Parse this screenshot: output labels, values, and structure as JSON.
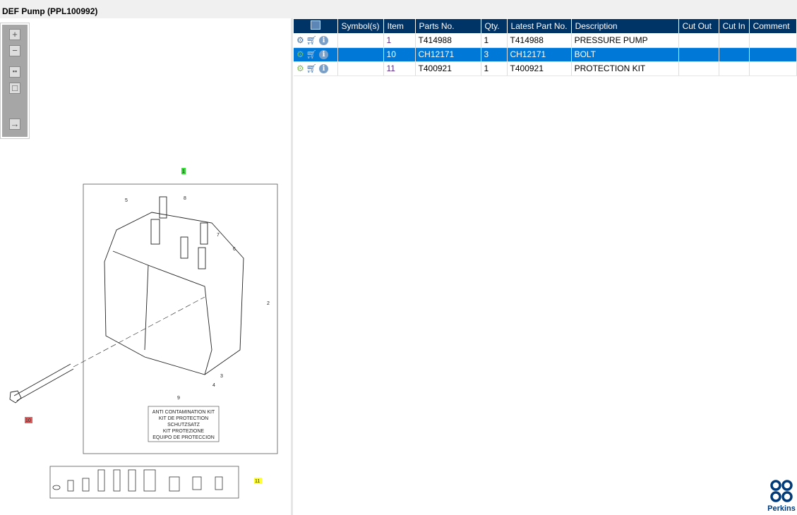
{
  "title": "DEF Pump (PPL100992)",
  "toolbar": {
    "icons": [
      "zoom-in-icon",
      "zoom-out-icon",
      "fit-all-icon",
      "fit-window-icon",
      "export-icon"
    ]
  },
  "table": {
    "columns": [
      "",
      "Symbol(s)",
      "Item",
      "Parts No.",
      "Qty.",
      "Latest Part No.",
      "Description",
      "Cut Out",
      "Cut In",
      "Comment"
    ],
    "rows": [
      {
        "symbols": "",
        "item": "1",
        "part": "T414988",
        "qty": "1",
        "latest": "T414988",
        "desc": "PRESSURE PUMP",
        "cut_out": "",
        "cut_in": "",
        "comment": ""
      },
      {
        "symbols": "",
        "item": "10",
        "part": "CH12171",
        "qty": "3",
        "latest": "CH12171",
        "desc": "BOLT",
        "cut_out": "",
        "cut_in": "",
        "comment": ""
      },
      {
        "symbols": "",
        "item": "11",
        "part": "T400921",
        "qty": "1",
        "latest": "T400921",
        "desc": "PROTECTION KIT",
        "cut_out": "",
        "cut_in": "",
        "comment": ""
      }
    ],
    "selected_row": 1
  },
  "diagram": {
    "callouts": [
      "1",
      "2",
      "3",
      "4",
      "5",
      "6",
      "7",
      "8",
      "9",
      "10",
      "11"
    ],
    "kit_label": [
      "ANTI CONTAMINATION KIT",
      "KIT DE PROTECTION",
      "SCHUTZSATZ",
      "KIT PROTEZIONE",
      "EQUIPO DE PROTECCION"
    ],
    "highlight_colors": {
      "1": "#33dd33",
      "10": "#e06060",
      "11": "#ffff33"
    }
  },
  "logo": {
    "text": "Perkins"
  }
}
